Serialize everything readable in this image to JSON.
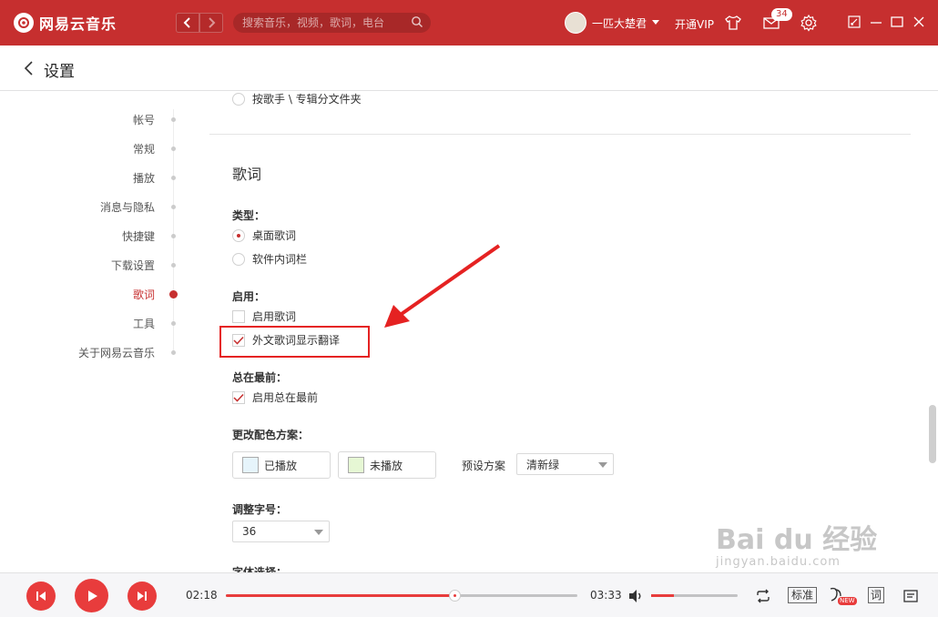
{
  "app": {
    "name": "网易云音乐",
    "brand_color": "#c62f2f"
  },
  "header": {
    "search_placeholder": "搜索音乐，视频，歌词，电台",
    "username": "一匹大楚君",
    "vip_label": "开通VIP",
    "mail_badge": "34",
    "icons": [
      "chevron-left-icon",
      "chevron-right-icon",
      "search-icon",
      "tshirt-icon",
      "mail-icon",
      "gear-icon",
      "mini-mode-icon",
      "minimize-icon",
      "maximize-icon",
      "close-icon"
    ]
  },
  "page": {
    "title": "设置"
  },
  "sidebar": {
    "items": [
      {
        "label": "帐号",
        "active": false
      },
      {
        "label": "常规",
        "active": false
      },
      {
        "label": "播放",
        "active": false
      },
      {
        "label": "消息与隐私",
        "active": false
      },
      {
        "label": "快捷键",
        "active": false
      },
      {
        "label": "下载设置",
        "active": false
      },
      {
        "label": "歌词",
        "active": true
      },
      {
        "label": "工具",
        "active": false
      },
      {
        "label": "关于网易云音乐",
        "active": false
      }
    ]
  },
  "settings": {
    "prev_option": "按歌手 \\ 专辑分文件夹",
    "section_title": "歌词",
    "type_label": "类型：",
    "type_options": [
      {
        "label": "桌面歌词",
        "checked": true
      },
      {
        "label": "软件内词栏",
        "checked": false
      }
    ],
    "enable_label": "启用：",
    "enable_options": [
      {
        "label": "启用歌词",
        "checked": false
      },
      {
        "label": "外文歌词显示翻译",
        "checked": true
      }
    ],
    "ontop_label": "总在最前：",
    "ontop_option": {
      "label": "启用总在最前",
      "checked": true
    },
    "color_label": "更改配色方案：",
    "played_label": "已播放",
    "played_color": "#e6f4fb",
    "unplayed_label": "未播放",
    "unplayed_color": "#e6f7d4",
    "preset_label": "预设方案",
    "preset_value": "清新绿",
    "font_size_label": "调整字号：",
    "font_size_value": "36",
    "font_select_label": "字体选择："
  },
  "annotation": {
    "highlight_color": "#e52222"
  },
  "player": {
    "current_time": "02:18",
    "total_time": "03:33",
    "progress": 0.65,
    "volume": 0.26,
    "quality_label": "标准",
    "lyric_label": "词",
    "new_badge": "NEW",
    "icons": [
      "prev-icon",
      "play-icon",
      "next-icon",
      "volume-icon",
      "loop-icon",
      "sound-effect-icon",
      "playlist-icon"
    ]
  },
  "watermark": {
    "main": "Bai du 经验",
    "sub": "jingyan.baidu.com"
  }
}
